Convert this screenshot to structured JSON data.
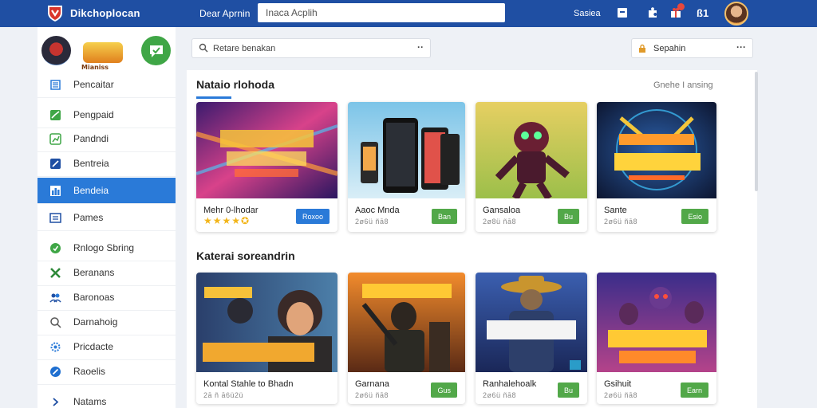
{
  "colors": {
    "topbar": "#1f4fa3",
    "accent": "#2a7ad8",
    "install_green": "#52a849",
    "star": "#f2b51a"
  },
  "header": {
    "brand": "Dikchoplocan",
    "link": "Dear Aprnin",
    "search": {
      "value": "",
      "placeholder": "Inaca Acplih"
    },
    "label": "Sasiea",
    "icons": [
      "document-icon",
      "puzzle-icon",
      "gift-icon",
      "grid-icon"
    ],
    "text_icon": "ß1",
    "avatar": "user-avatar"
  },
  "sidebar": {
    "promo_label": "Mianiss",
    "items": [
      {
        "label": "Pencaitar",
        "icon": "list-icon"
      },
      {
        "label": "Pengpaid",
        "icon": "chart-icon"
      },
      {
        "label": "Pandndi",
        "icon": "trend-icon"
      },
      {
        "label": "Bentreia",
        "icon": "edit-icon"
      },
      {
        "label": "Bendeia",
        "icon": "grid-icon",
        "active": true
      },
      {
        "label": "Pames",
        "icon": "doc-icon"
      },
      {
        "label": "Rnlogo Sbring",
        "icon": "shield-icon"
      },
      {
        "label": "Beranans",
        "icon": "cross-icon"
      },
      {
        "label": "Baronoas",
        "icon": "users-icon"
      },
      {
        "label": "Darnahoig",
        "icon": "search-icon"
      },
      {
        "label": "Pricdacte",
        "icon": "gear-icon"
      },
      {
        "label": "Raoelis",
        "icon": "edit-circle-icon"
      },
      {
        "label": "Natams",
        "icon": "chevron-right-icon"
      }
    ]
  },
  "toolbar": {
    "filter_text": "Retare benakan",
    "sort_text": "Sepahin"
  },
  "sections": [
    {
      "title": "Nataio rlohoda",
      "link": "Gnehe I ansing",
      "cards": [
        {
          "title": "Mehr 0-lhodar",
          "stars": "★★★★✪",
          "button": "Roxoo",
          "button_style": "blue",
          "art": "neon-title"
        },
        {
          "title": "Aaoc Mnda",
          "sub": "2ø6ü ñā8",
          "button": "Ban",
          "button_style": "green",
          "art": "phones"
        },
        {
          "title": "Gansaloa",
          "sub": "2ø8ü ñā8",
          "button": "Bu",
          "button_style": "green",
          "art": "robot"
        },
        {
          "title": "Sante",
          "sub": "2ø6ü ñā8",
          "button": "Esio",
          "button_style": "green",
          "art": "emblem"
        }
      ]
    },
    {
      "title": "Katerai soreandrin",
      "cards": [
        {
          "title": "Kontal Stahle to Bhadn",
          "sub": "2ā ñ ā6ü2ü",
          "button": "",
          "button_style": "none",
          "art": "hero-girl"
        },
        {
          "title": "Garnana",
          "sub": "2ø6ü ñā8",
          "button": "Gus",
          "button_style": "green",
          "art": "soldier"
        },
        {
          "title": "Ranhalehoalk",
          "sub": "2ø6ü ñā8",
          "button": "Bu",
          "button_style": "green",
          "art": "cowboy"
        },
        {
          "title": "Gsihuit",
          "sub": "2ø6ü ñā8",
          "button": "Earn",
          "button_style": "green",
          "art": "scifi"
        }
      ]
    }
  ]
}
